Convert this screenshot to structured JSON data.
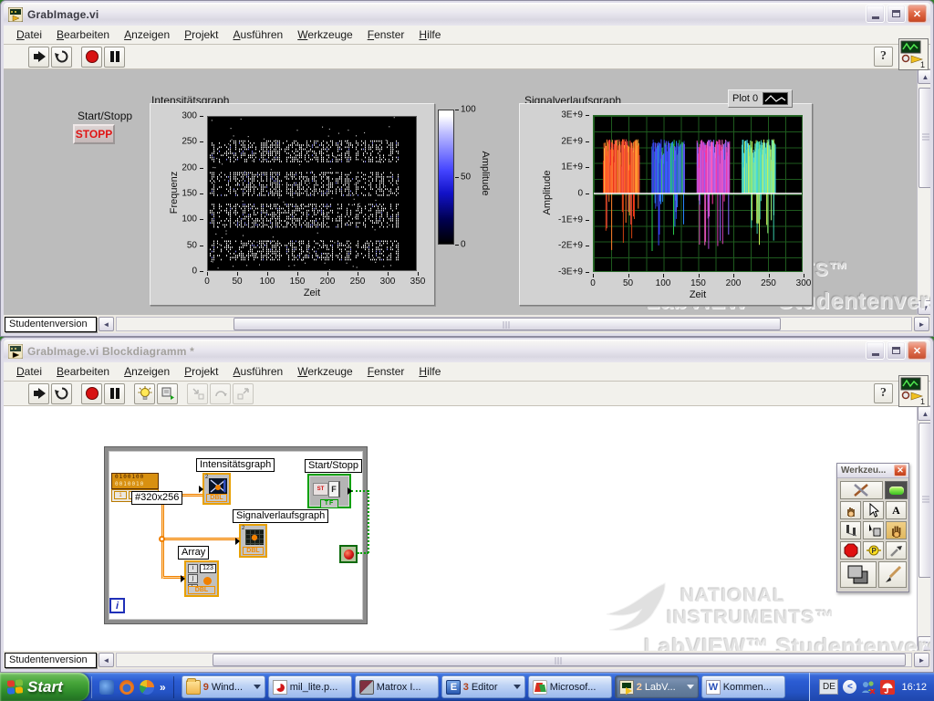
{
  "front_window": {
    "title": "GrabImage.vi",
    "menu": [
      "Datei",
      "Bearbeiten",
      "Anzeigen",
      "Projekt",
      "Ausführen",
      "Werkzeuge",
      "Fenster",
      "Hilfe"
    ],
    "help_button": "?",
    "badge_number": "1",
    "start_stop_label": "Start/Stopp",
    "stop_button": "STOPP",
    "status_version": "Studentenversion"
  },
  "block_window": {
    "title": "GrabImage.vi Blockdiagramm *",
    "menu": [
      "Datei",
      "Bearbeiten",
      "Anzeigen",
      "Projekt",
      "Ausführen",
      "Werkzeuge",
      "Fenster",
      "Hilfe"
    ],
    "help_button": "?",
    "badge_number": "1",
    "status_version": "Studentenversion",
    "nodes": {
      "size_label": "#320x256",
      "intensity_label": "Intensitätsgraph",
      "waveform_label": "Signalverlaufsgraph",
      "array_label": "Array",
      "bool_label": "Start/Stopp",
      "bool_st": "ST",
      "bool_f": "F",
      "bool_tf": "TF",
      "dbl": "DBL",
      "num123": "123",
      "ijk": [
        "i",
        "j",
        "k"
      ],
      "iteration": "i",
      "binary_row1": "0100100",
      "binary_row2": "0010010",
      "mini_two": "2"
    },
    "palette": {
      "title": "Werkzeu..."
    }
  },
  "watermark": {
    "line1": "NATIONAL",
    "line2": "INSTRUMENTS™",
    "line3": "LabVIEW™ Studentenversion"
  },
  "chart_data": [
    {
      "name": "intensity_graph",
      "type": "heatmap",
      "title": "Intensitätsgraph",
      "xlabel": "Zeit",
      "ylabel": "Frequenz",
      "xlim": [
        0,
        350
      ],
      "ylim": [
        0,
        300
      ],
      "xticks": [
        0,
        50,
        100,
        150,
        200,
        250,
        300,
        350
      ],
      "yticks": [
        0,
        50,
        100,
        150,
        200,
        250,
        300
      ],
      "colorbar": {
        "label": "Amplitude",
        "ticks": [
          100,
          50,
          0
        ],
        "colors": [
          "#ffffff",
          "#3535ff",
          "#000000"
        ]
      },
      "background": "#000000",
      "dot_color": "#ffffff",
      "data_extent_x": 320,
      "bands_frequency": [
        [
          22,
          62
        ],
        [
          86,
          132
        ],
        [
          148,
          196
        ],
        [
          214,
          256
        ]
      ]
    },
    {
      "name": "waveform_graph",
      "type": "line",
      "title": "Signalverlaufsgraph",
      "legend": [
        "Plot 0"
      ],
      "legend_position": "top-right",
      "xlabel": "Zeit",
      "ylabel": "Amplitude",
      "xlim": [
        0,
        300
      ],
      "ylim": [
        -3000000000,
        3000000000
      ],
      "xticks": [
        0,
        50,
        100,
        150,
        200,
        250,
        300
      ],
      "ytick_labels_top_down": [
        "3E+9",
        "2E+9",
        "1E+9",
        "0",
        "-1E+9",
        "-2E+9",
        "-3E+9"
      ],
      "grid": true,
      "grid_color": "#1e5a1e",
      "background": "#000000",
      "zero_line_color": "#ffffff",
      "bursts": [
        {
          "x_range": [
            14,
            66
          ],
          "amp_pos": 2100000000,
          "amp_neg": -2250000000,
          "colors": [
            "#ff3020",
            "#ff7828",
            "#ffa838",
            "#f05048",
            "#d04010"
          ]
        },
        {
          "x_range": [
            84,
            131
          ],
          "amp_pos": 2100000000,
          "amp_neg": -2300000000,
          "colors": [
            "#3848ff",
            "#2888ff",
            "#28c848",
            "#6858ff",
            "#2838c0"
          ]
        },
        {
          "x_range": [
            149,
            196
          ],
          "amp_pos": 2100000000,
          "amp_neg": -2200000000,
          "colors": [
            "#ff38a0",
            "#b848d8",
            "#8868ff",
            "#ff68c8",
            "#d840b8"
          ]
        },
        {
          "x_range": [
            214,
            262
          ],
          "amp_pos": 2100000000,
          "amp_neg": -2200000000,
          "colors": [
            "#c8f058",
            "#58e8c0",
            "#48d8f0",
            "#98f078",
            "#38c8a8"
          ]
        }
      ]
    }
  ],
  "taskbar": {
    "start": "Start",
    "quick_launch_more": "»",
    "buttons": [
      {
        "count": "9",
        "label": "Wind...",
        "icon": "folder",
        "dropdown": true,
        "active": false
      },
      {
        "count": "",
        "label": "mil_lite.p...",
        "icon": "pdf",
        "dropdown": false,
        "active": false
      },
      {
        "count": "",
        "label": "Matrox I...",
        "icon": "matrox",
        "dropdown": false,
        "active": false
      },
      {
        "count": "3",
        "label": "Editor",
        "icon": "editor",
        "dropdown": true,
        "active": false
      },
      {
        "count": "",
        "label": "Microsof...",
        "icon": "office",
        "dropdown": false,
        "active": false
      },
      {
        "count": "2",
        "label": "LabV...",
        "icon": "labview",
        "dropdown": true,
        "active": true
      },
      {
        "count": "",
        "label": "Kommen...",
        "icon": "word",
        "dropdown": false,
        "active": false
      }
    ],
    "tray": {
      "lang": "DE",
      "clock": "16:12"
    }
  }
}
